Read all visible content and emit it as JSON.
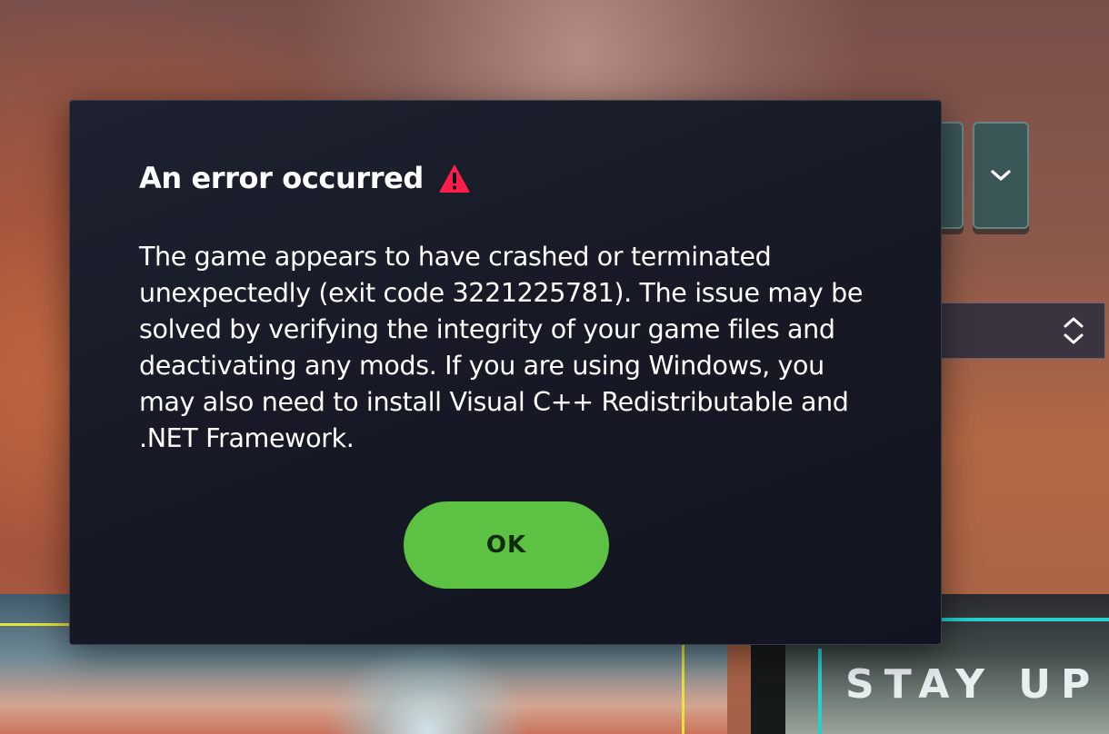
{
  "background": {
    "banner_text": "STAY UP T",
    "dropdown_icon": "chevron-down-icon",
    "select_icon": "updown-arrows-icon",
    "colors": {
      "teal_button": "#3b5656",
      "yellow_accent": "#e6e33a",
      "cyan_accent": "#26d0cf"
    }
  },
  "dialog": {
    "title": "An error occurred",
    "title_icon": "warning-icon",
    "warning_color": "#ff1e4b",
    "message_lines": [
      "The game appears to have crashed or terminated",
      "unexpectedly (exit code 3221225781). The issue may be",
      "solved by verifying the integrity of your game files and",
      "deactivating any mods. If you are using Windows, you",
      "may also need to install Visual C++ Redistributable and",
      ".NET Framework."
    ],
    "ok_label": "OK",
    "ok_color": "#5dc144"
  }
}
